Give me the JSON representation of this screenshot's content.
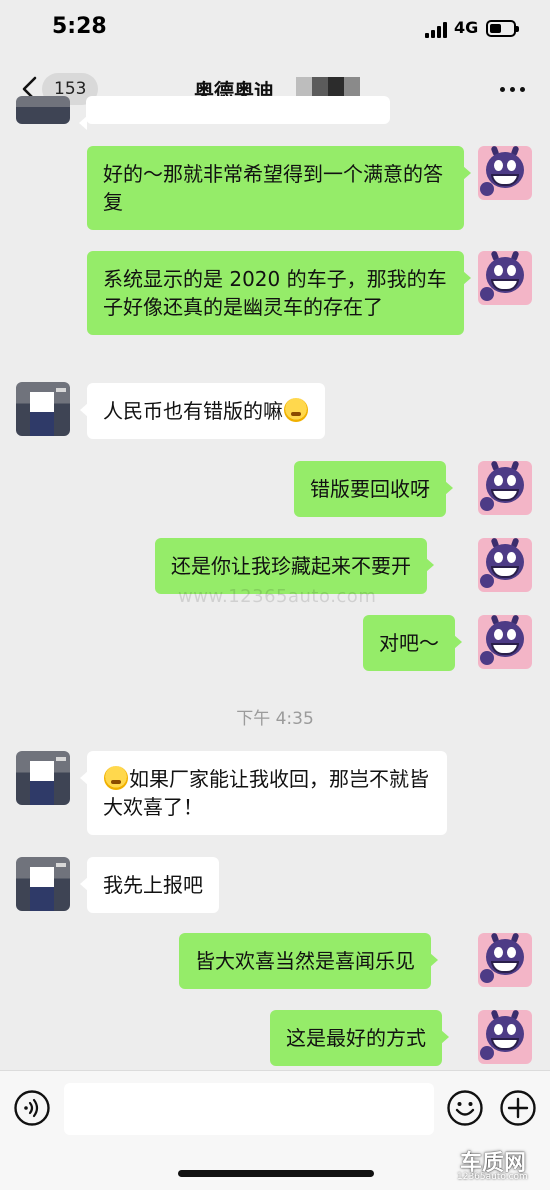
{
  "status_bar": {
    "time": "5:28",
    "network": "4G"
  },
  "nav": {
    "back_count": "153",
    "title": "奥德奥迪"
  },
  "watermark": "www.12365auto.com",
  "timestamp": "下午 4:35",
  "messages": [
    {
      "side": "self",
      "text": "好的～那就非常希望得到一个满意的答复"
    },
    {
      "side": "self",
      "text": "系统显示的是 2020 的车子，那我的车子好像还真的是幽灵车的存在了"
    },
    {
      "side": "other",
      "text": "人民币也有错版的嘛",
      "emoji": "face-with-tears-of-joy"
    },
    {
      "side": "self",
      "text": "错版要回收呀"
    },
    {
      "side": "self",
      "text": "还是你让我珍藏起来不要开"
    },
    {
      "side": "self",
      "text": "对吧～"
    },
    {
      "side": "other",
      "text": "如果厂家能让我收回，那岂不就皆大欢喜了！",
      "emoji": "face-with-tears-of-joy"
    },
    {
      "side": "other",
      "text": "我先上报吧"
    },
    {
      "side": "self",
      "text": "皆大欢喜当然是喜闻乐见"
    },
    {
      "side": "self",
      "text": "这是最好的方式"
    }
  ],
  "input_bar": {
    "voice_icon": "voice-icon",
    "emoji_icon": "smiley-icon",
    "plus_icon": "plus-icon"
  },
  "logo": {
    "main": "车质网",
    "sub": "12365auto.com"
  },
  "colors": {
    "self_bubble": "#95ec69",
    "other_bubble": "#ffffff",
    "background": "#ededed"
  }
}
